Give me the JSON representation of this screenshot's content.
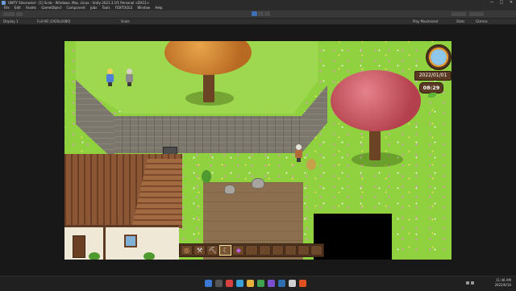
{
  "window": {
    "title": "UNITY Silverwind - [1] Scnb - Windows, Mac, Linux - Unity 2021.3.1f1 Personal <DX11>",
    "minimize": "—",
    "maximize": "□",
    "close": "✕"
  },
  "menu": [
    "File",
    "Edit",
    "Assets",
    "GameObject",
    "Component",
    "Jobs",
    "Tools",
    "FOXTOOLS",
    "Window",
    "Help"
  ],
  "gamebar": {
    "display": "Display 1",
    "aspect": "Full HD (1920x1080)",
    "scale": "Scale",
    "play_mode": "Play Maximized",
    "stats": "Stats",
    "gizmos": "Gizmos"
  },
  "hud": {
    "date": "2022/01/01",
    "time": "08:29"
  },
  "hotbar": {
    "slots": [
      {
        "icon": "seed-bag-icon",
        "glyph": "◎"
      },
      {
        "icon": "shovel-icon",
        "glyph": "⚒"
      },
      {
        "icon": "pickaxe-icon",
        "glyph": "⛏"
      },
      {
        "icon": "sickle-icon",
        "glyph": "☾"
      },
      {
        "icon": "potion-icon",
        "glyph": "◆"
      },
      {
        "icon": "empty-slot",
        "glyph": ""
      },
      {
        "icon": "empty-slot",
        "glyph": ""
      },
      {
        "icon": "empty-slot",
        "glyph": ""
      },
      {
        "icon": "empty-slot",
        "glyph": ""
      },
      {
        "icon": "empty-slot",
        "glyph": ""
      },
      {
        "icon": "empty-slot",
        "glyph": ""
      }
    ],
    "active_index": 3
  },
  "taskbar": {
    "time": "11:46 AM",
    "date": "2022/6/16"
  },
  "colors": {
    "grass": "#8fd13f",
    "hud_wood": "#5a3a22",
    "taskbar": "#202020",
    "play_button": "#3d6fb4"
  }
}
